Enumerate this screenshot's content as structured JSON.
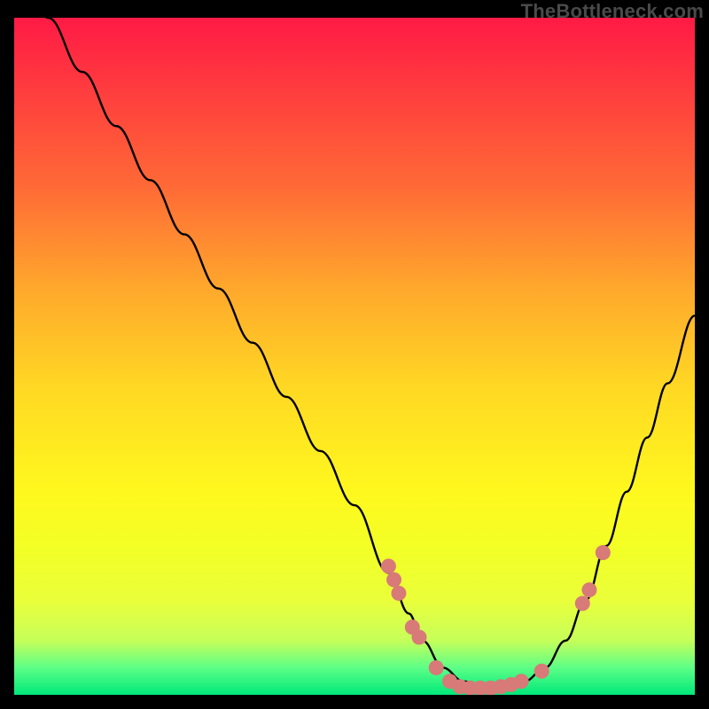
{
  "attribution": "TheBottleneck.com",
  "colors": {
    "frame": "#000000",
    "curve_stroke": "#000000",
    "dot_fill": "#d77a78",
    "gradient_stops": [
      "#ff1a45",
      "#ff3a3f",
      "#ff6a36",
      "#ffa82c",
      "#ffd923",
      "#fff81e",
      "#f3ff25",
      "#eaff3a",
      "#c6ff5a",
      "#5cff86",
      "#00e87a"
    ]
  },
  "chart_data": {
    "type": "line",
    "title": "",
    "xlabel": "",
    "ylabel": "",
    "xlim": [
      0,
      100
    ],
    "ylim": [
      0,
      100
    ],
    "series": [
      {
        "name": "curve",
        "x": [
          0,
          5,
          10,
          15,
          20,
          25,
          30,
          35,
          40,
          45,
          50,
          55,
          58,
          60,
          63,
          66,
          69,
          72,
          75,
          78,
          81,
          84,
          87,
          90,
          93,
          96,
          100
        ],
        "y": [
          108,
          100,
          92,
          84,
          76,
          68,
          60,
          52,
          44,
          36,
          28,
          18,
          12,
          8,
          4,
          2,
          1,
          1,
          2,
          4,
          8,
          14,
          22,
          30,
          38,
          46,
          56
        ]
      }
    ],
    "markers": [
      {
        "x": 55.0,
        "y": 19.0
      },
      {
        "x": 55.8,
        "y": 17.0
      },
      {
        "x": 56.5,
        "y": 15.0
      },
      {
        "x": 58.5,
        "y": 10.0
      },
      {
        "x": 59.5,
        "y": 8.5
      },
      {
        "x": 62.0,
        "y": 4.0
      },
      {
        "x": 64.0,
        "y": 2.0
      },
      {
        "x": 65.5,
        "y": 1.2
      },
      {
        "x": 67.0,
        "y": 1.0
      },
      {
        "x": 68.5,
        "y": 1.0
      },
      {
        "x": 70.0,
        "y": 1.0
      },
      {
        "x": 71.5,
        "y": 1.2
      },
      {
        "x": 73.0,
        "y": 1.5
      },
      {
        "x": 74.5,
        "y": 2.0
      },
      {
        "x": 77.5,
        "y": 3.5
      },
      {
        "x": 83.5,
        "y": 13.5
      },
      {
        "x": 84.5,
        "y": 15.5
      },
      {
        "x": 86.5,
        "y": 21.0
      }
    ]
  }
}
